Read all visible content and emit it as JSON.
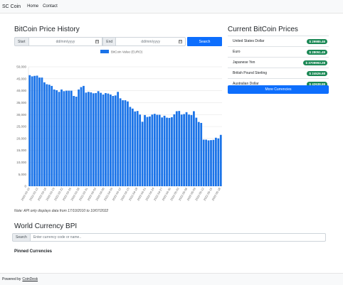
{
  "navbar": {
    "brand": "SC Coin",
    "links": [
      "Home",
      "Contact"
    ]
  },
  "history": {
    "title": "BitCoin Price History",
    "start_label": "Start",
    "end_label": "End",
    "date_placeholder": "dd/mm/yyyy",
    "search_label": "Search",
    "note": "Note: API only displays data from 17/10/2010 to 10/07/2022"
  },
  "chart_data": {
    "type": "bar",
    "legend": "BitCoin Value (EURO)",
    "legend_position": "top",
    "ylim": [
      0,
      50000
    ],
    "yticks": [
      0,
      5000,
      10000,
      15000,
      20000,
      25000,
      30000,
      35000,
      40000,
      45000,
      50000
    ],
    "ytick_labels": [
      "0",
      "5,000",
      "10,000",
      "15,000",
      "20,000",
      "25,000",
      "30,000",
      "35,000",
      "40,000",
      "45,000",
      "50,000"
    ],
    "color": "#1a73e8",
    "grid": true,
    "categories": [
      "2022-03-10",
      "2022-03-11",
      "2022-03-12",
      "2022-03-13",
      "2022-03-14",
      "2022-03-15",
      "2022-03-16",
      "2022-03-17",
      "2022-03-18",
      "2022-03-19",
      "2022-03-20",
      "2022-03-21",
      "2022-03-22",
      "2022-03-23",
      "2022-03-24",
      "2022-03-25",
      "2022-03-26",
      "2022-03-27",
      "2022-03-28",
      "2022-03-29",
      "2022-03-30",
      "2022-03-31",
      "2022-04-01",
      "2022-04-02",
      "2022-04-03",
      "2022-04-04",
      "2022-04-05",
      "2022-04-06",
      "2022-04-07",
      "2022-04-08",
      "2022-04-09",
      "2022-04-10",
      "2022-04-11",
      "2022-04-12",
      "2022-04-13",
      "2022-04-14",
      "2022-04-15",
      "2022-04-16",
      "2022-04-17",
      "2022-04-18",
      "2022-04-19",
      "2022-04-20",
      "2022-04-21",
      "2022-04-22",
      "2022-04-23",
      "2022-04-24",
      "2022-04-25",
      "2022-04-26",
      "2022-04-27",
      "2022-04-28",
      "2022-04-29",
      "2022-04-30",
      "2022-05-01",
      "2022-05-02",
      "2022-05-03",
      "2022-05-04",
      "2022-05-05",
      "2022-05-06",
      "2022-05-07",
      "2022-05-08",
      "2022-05-09",
      "2022-05-10",
      "2022-05-11",
      "2022-05-12",
      "2022-05-13",
      "2022-05-14",
      "2022-05-15",
      "2022-05-16",
      "2022-05-17",
      "2022-05-18"
    ],
    "values": [
      46500,
      46000,
      46200,
      46300,
      45500,
      45500,
      43500,
      42700,
      42500,
      42000,
      40500,
      40200,
      39500,
      40500,
      39800,
      40000,
      40000,
      40000,
      37800,
      37500,
      40500,
      41500,
      42000,
      39200,
      39500,
      39300,
      38900,
      39000,
      39800,
      39100,
      38400,
      39000,
      38800,
      38400,
      37800,
      38000,
      39500,
      36800,
      36000,
      36000,
      35500,
      33200,
      32500,
      31300,
      31500,
      30000,
      27000,
      29800,
      29000,
      29200,
      30000,
      30300,
      29900,
      29900,
      28800,
      29500,
      28700,
      28600,
      28900,
      30100,
      31400,
      31500,
      30000,
      30200,
      31000,
      30000,
      29800,
      31400,
      28700,
      26900,
      26500,
      19500,
      19500,
      19200,
      19300,
      19400,
      20300,
      20000,
      21500
    ]
  },
  "prices": {
    "title": "Current BitCoin Prices",
    "rows": [
      {
        "label": "United States Dollar",
        "value": "$ 29985.46"
      },
      {
        "label": "Euro",
        "value": "$ 28051.49"
      },
      {
        "label": "Japanese Yen",
        "value": "$ 3709993.28"
      },
      {
        "label": "British Pound Sterling",
        "value": "$ 24526.68"
      },
      {
        "label": "Australian Dollar",
        "value": "$ 42638.59"
      }
    ],
    "more_label": "More Currencies"
  },
  "bpi": {
    "title": "World Currency BPI",
    "search_label": "Search",
    "placeholder": "Enter currency code or name..",
    "pinned_title": "Pinned Currencies"
  },
  "footer": {
    "text": "Powered by",
    "link": "CoinDesk"
  }
}
